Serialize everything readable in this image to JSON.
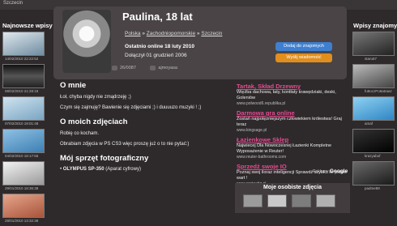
{
  "top": {
    "text": "Szczecin"
  },
  "left_sidebar": {
    "title": "Najnowsze wpisy",
    "items": [
      {
        "date": "14/02/2010 22:22:52"
      },
      {
        "date": "08/02/2010 21:28:18"
      },
      {
        "date": "07/02/2010 19:01:48"
      },
      {
        "date": "04/02/2010 18:17:55"
      },
      {
        "date": "29/01/2010 18:36:38"
      },
      {
        "date": "28/01/2010 13:32:38"
      }
    ]
  },
  "right_sidebar": {
    "title": "Wpisy znajomych",
    "items": [
      {
        "user": "staru67"
      },
      {
        "user": "fu8oczPo6atraaz"
      },
      {
        "user": "amaf"
      },
      {
        "user": "krazyabof"
      },
      {
        "user": "padme89"
      }
    ]
  },
  "profile": {
    "name": "Paulina, 18 lat",
    "breadcrumb": [
      "Polska",
      "Zachodniopomorskie",
      "Szczecin"
    ],
    "breadcrumb_sep": "»",
    "online_label": "Ostatnio online",
    "online_value": "18 luty 2010",
    "joined": "Dołączył 01 grudzień 2006",
    "stats": [
      "26/0087",
      "ajmoyasa"
    ],
    "add_friend": "Dodaj do znajomych",
    "send_message": "Wyślij wiadomość"
  },
  "about": {
    "title": "O mnie",
    "p1": "Łoł, chyba nigdy nie zmądrzeję ;)",
    "p2": "Czym się zajmuję? Bawienie się zdjęciami ;) i duuuuzo muzyki ! ;)"
  },
  "photos_about": {
    "title": "O moich zdjęciach",
    "p1": "Robię co kocham.",
    "p2": "Obrabiam zdjęcia w PS CS3 więc proszę już o to nie pytać:)"
  },
  "gear": {
    "title": "Mój sprzęt fotograficzny",
    "item_bold": "OLYMPUS SP-350",
    "item_rest": "(Aparat cyfrowy)"
  },
  "ads": [
    {
      "title": "Tartak, Skład Drzewny",
      "desc": "Więźba dachowa, łaty, kontłaty krawędziaki, deski, Goleniów",
      "url": "www.polwood6.republika.pl"
    },
    {
      "title": "Darmowa gra online",
      "desc": "Zostań najpotężniejszym człowiekiem królestwa! Graj teraz",
      "url": "www.kingsage.pl"
    },
    {
      "title": "Łazienkowe Sklep",
      "desc": "Najwiecej Dla Nowoczesnej Łazienki Kompletne Wyposażenie w Reuter!",
      "url": "www.reuter-bathrooms.com"
    },
    {
      "title": "Sprzedź swoje IO",
      "desc": "Poznaj swoj iloraz inteligencji Sprawdź szybko ile jesteś wart !",
      "url": "www.protestiq.pl"
    }
  ],
  "ads_by": {
    "label": "Reklamy",
    "brand": "Google"
  },
  "my_photos": {
    "title": "Moje osobiste zdjęcia"
  }
}
